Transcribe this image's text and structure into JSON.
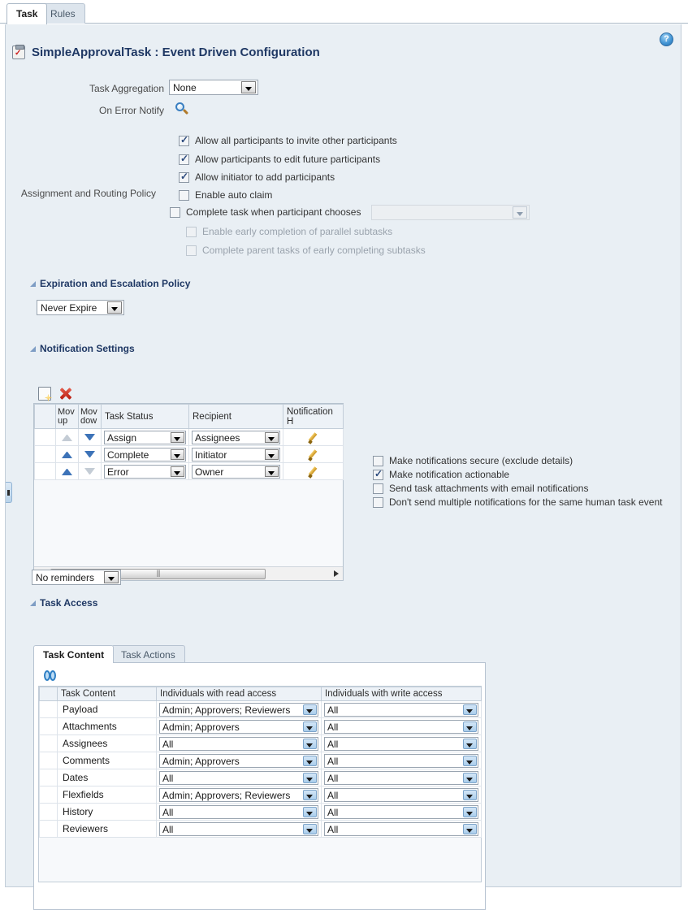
{
  "tabs": [
    {
      "label": "Task",
      "active": true
    },
    {
      "label": "Rules",
      "active": false
    }
  ],
  "help": {
    "label": "?"
  },
  "header": {
    "title": "SimpleApprovalTask : Event Driven Configuration",
    "icon": "task-form-icon"
  },
  "form": {
    "task_aggregation_label": "Task Aggregation",
    "task_aggregation_value": "None",
    "on_error_notify_label": "On Error Notify",
    "on_error_notify_icon": "search-icon"
  },
  "assignment": {
    "label": "Assignment and Routing Policy",
    "options": [
      {
        "label": "Allow all participants to invite other participants",
        "checked": true,
        "disabled": false
      },
      {
        "label": "Allow participants to edit future participants",
        "checked": true,
        "disabled": false
      },
      {
        "label": "Allow initiator to add participants",
        "checked": true,
        "disabled": false
      },
      {
        "label": "Enable auto claim",
        "checked": false,
        "disabled": false
      },
      {
        "label": "Complete task when participant chooses",
        "checked": false,
        "disabled": false
      },
      {
        "label": "Enable early completion of parallel subtasks",
        "checked": false,
        "disabled": true
      },
      {
        "label": "Complete parent tasks of early completing subtasks",
        "checked": false,
        "disabled": true
      }
    ],
    "complete_task_value": ""
  },
  "expiration": {
    "section_title": "Expiration and Escalation Policy",
    "value": "Never Expire"
  },
  "notifications": {
    "section_title": "Notification Settings",
    "toolbar": {
      "new_label": "new-row-icon",
      "delete_label": "delete-row-icon"
    },
    "columns": [
      "",
      "Mov up",
      "Mov dow",
      "Task Status",
      "Recipient",
      "Notification H"
    ],
    "rows": [
      {
        "status": "Assign",
        "recipient": "Assignees",
        "up_enabled": false,
        "down_enabled": true
      },
      {
        "status": "Complete",
        "recipient": "Initiator",
        "up_enabled": true,
        "down_enabled": true
      },
      {
        "status": "Error",
        "recipient": "Owner",
        "up_enabled": true,
        "down_enabled": false
      }
    ],
    "checkboxes": [
      {
        "label": "Make notifications secure (exclude details)",
        "checked": false
      },
      {
        "label": "Make notification actionable",
        "checked": true
      },
      {
        "label": "Send task attachments with email notifications",
        "checked": false
      },
      {
        "label": "Don't send multiple notifications for the same human task event",
        "checked": false
      }
    ],
    "reminders_value": "No reminders"
  },
  "task_access": {
    "section_title": "Task Access",
    "tabs": [
      {
        "label": "Task Content",
        "active": true
      },
      {
        "label": "Task Actions",
        "active": false
      }
    ],
    "refresh_icon": "refresh-icon",
    "columns": [
      "",
      "Task Content",
      "Individuals with read access",
      "",
      "Individuals with write access",
      ""
    ],
    "rows": [
      {
        "content": "Payload",
        "read": "Admin; Approvers; Reviewers",
        "write": "All"
      },
      {
        "content": "Attachments",
        "read": "Admin; Approvers",
        "write": "All"
      },
      {
        "content": "Assignees",
        "read": "All",
        "write": "All"
      },
      {
        "content": "Comments",
        "read": "Admin; Approvers",
        "write": "All"
      },
      {
        "content": "Dates",
        "read": "All",
        "write": "All"
      },
      {
        "content": "Flexfields",
        "read": "Admin; Approvers; Reviewers",
        "write": "All"
      },
      {
        "content": "History",
        "read": "All",
        "write": "All"
      },
      {
        "content": "Reviewers",
        "read": "All",
        "write": "All"
      }
    ]
  },
  "colors": {
    "panel_bg": "#e9eff4",
    "title": "#1f3864",
    "section_title": "#1f3864",
    "border": "#c3ced9",
    "accent_blue": "#3d73b8"
  }
}
